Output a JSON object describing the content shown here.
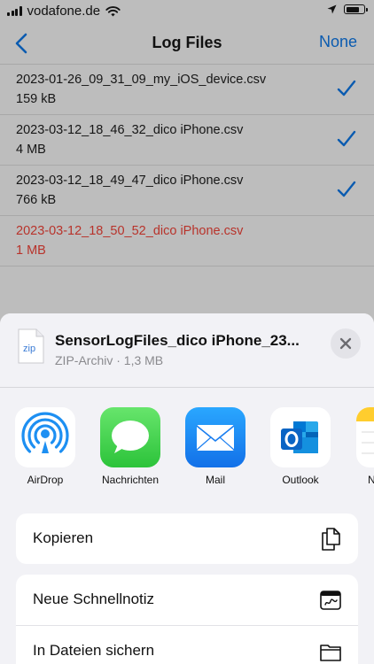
{
  "status_bar": {
    "carrier": "vodafone.de"
  },
  "nav": {
    "back_icon": "chevron-left-icon",
    "title": "Log Files",
    "right_button": "None"
  },
  "files": [
    {
      "name": "2023-01-26_09_31_09_my_iOS_device.csv",
      "size": "159 kB",
      "checked": true,
      "error": false
    },
    {
      "name": "2023-03-12_18_46_32_dico iPhone.csv",
      "size": "4 MB",
      "checked": true,
      "error": false
    },
    {
      "name": "2023-03-12_18_49_47_dico iPhone.csv",
      "size": "766 kB",
      "checked": true,
      "error": false
    },
    {
      "name": "2023-03-12_18_50_52_dico iPhone.csv",
      "size": "1 MB",
      "checked": false,
      "error": true
    }
  ],
  "share_sheet": {
    "doc_icon_label": "zip",
    "title": "SensorLogFiles_dico iPhone_23...",
    "subtitle": "ZIP-Archiv · 1,3 MB",
    "apps": [
      {
        "label": "AirDrop",
        "icon": "airdrop-icon"
      },
      {
        "label": "Nachrichten",
        "icon": "messages-icon"
      },
      {
        "label": "Mail",
        "icon": "mail-icon"
      },
      {
        "label": "Outlook",
        "icon": "outlook-icon"
      },
      {
        "label": "N",
        "icon": "notes-icon"
      }
    ],
    "actions": [
      {
        "label": "Kopieren",
        "icon": "copy-icon"
      },
      {
        "label": "Neue Schnellnotiz",
        "icon": "quick-note-icon"
      },
      {
        "label": "In Dateien sichern",
        "icon": "folder-icon"
      }
    ]
  },
  "colors": {
    "accent": "#0a5bb0",
    "error": "#b8332b",
    "check": "#0a5bb0"
  }
}
